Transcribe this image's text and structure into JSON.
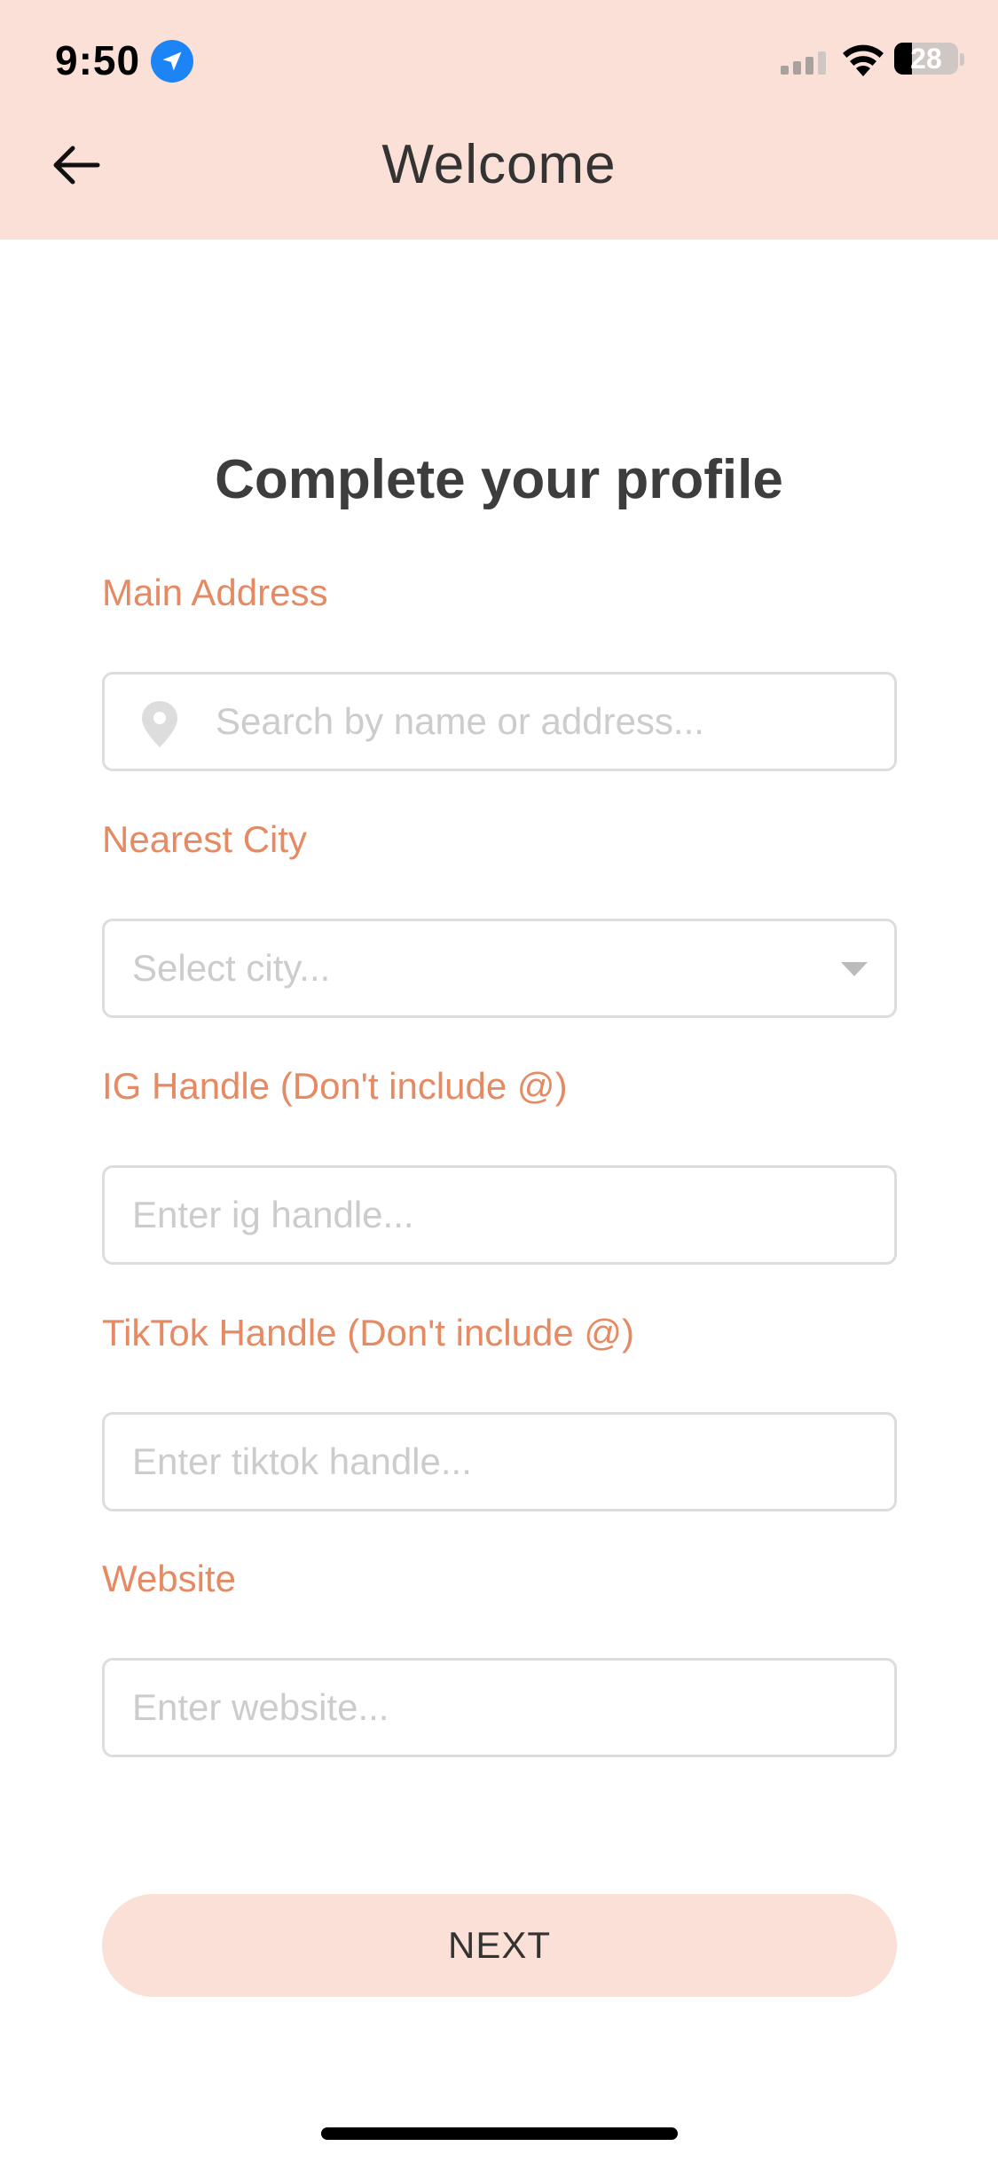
{
  "status_bar": {
    "time": "9:50",
    "battery_level": "28",
    "battery_fraction": 0.28,
    "location_icon": "location-arrow-icon",
    "signal_icon": "cellular-signal-icon",
    "wifi_icon": "wifi-icon",
    "battery_icon": "battery-icon"
  },
  "header": {
    "title": "Welcome",
    "back_icon": "arrow-left-icon",
    "background_color": "#fae0d6"
  },
  "main": {
    "title": "Complete your profile",
    "accent_color": "#e58a62",
    "fields": {
      "address": {
        "label": "Main Address",
        "placeholder": "Search by name or address...",
        "icon": "map-pin-icon"
      },
      "city": {
        "label": "Nearest City",
        "placeholder": "Select city...",
        "icon": "chevron-down-icon"
      },
      "ig": {
        "label": "IG Handle (Don't include @)",
        "placeholder": "Enter ig handle..."
      },
      "tiktok": {
        "label": "TikTok Handle (Don't include @)",
        "placeholder": "Enter tiktok handle..."
      },
      "website": {
        "label": "Website",
        "placeholder": "Enter website..."
      }
    },
    "next_button": {
      "label": "NEXT"
    }
  }
}
